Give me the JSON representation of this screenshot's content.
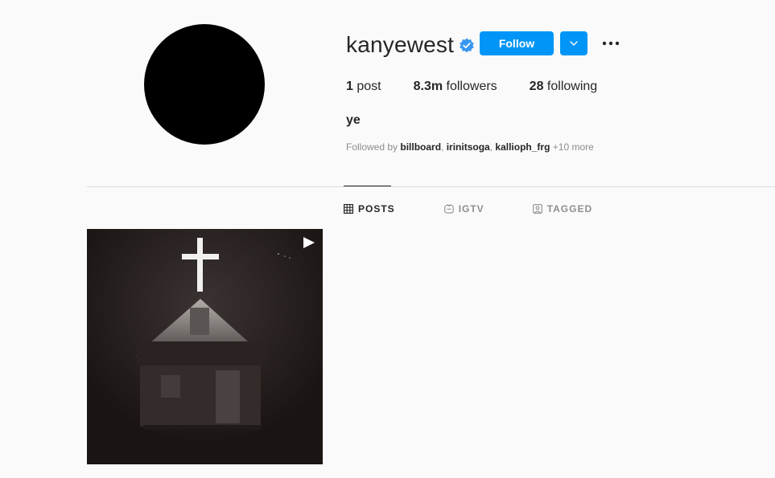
{
  "profile": {
    "username": "kanyewest",
    "verified": true,
    "follow_label": "Follow",
    "full_name": "ye"
  },
  "stats": {
    "posts_count": "1",
    "posts_label": "post",
    "followers_count": "8.3m",
    "followers_label": "followers",
    "following_count": "28",
    "following_label": "following"
  },
  "followed_by": {
    "prefix": "Followed by",
    "accounts": [
      "billboard",
      "irinitsoga",
      "kallioph_frg"
    ],
    "more": "+10 more"
  },
  "tabs": [
    {
      "label": "POSTS",
      "icon": "grid-icon",
      "active": true
    },
    {
      "label": "IGTV",
      "icon": "igtv-icon",
      "active": false
    },
    {
      "label": "TAGGED",
      "icon": "tagged-icon",
      "active": false
    }
  ],
  "posts": [
    {
      "type": "video",
      "subject": "church with lit cross at night"
    }
  ],
  "colors": {
    "accent": "#0095f6",
    "text": "#262626",
    "muted": "#8e8e8e",
    "background": "#fafafa",
    "verified": "#3897f0"
  }
}
